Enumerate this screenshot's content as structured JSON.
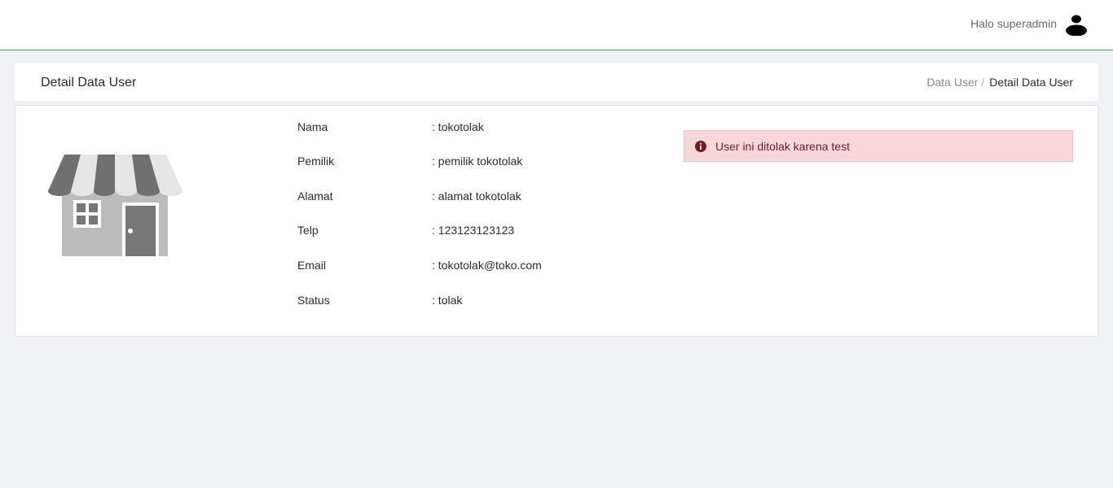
{
  "topbar": {
    "greeting": "Halo superadmin",
    "avatar_icon": "user-icon"
  },
  "header": {
    "title": "Detail Data User",
    "breadcrumb": {
      "link": "Data User",
      "separator": "/",
      "current": "Detail Data User"
    }
  },
  "detail": {
    "image_icon": "shop-storefront-icon",
    "rows": [
      {
        "label": "Nama",
        "value": ": tokotolak"
      },
      {
        "label": "Pemilik",
        "value": ": pemilik tokotolak"
      },
      {
        "label": "Alamat",
        "value": ": alamat tokotolak"
      },
      {
        "label": "Telp",
        "value": ": 123123123123"
      },
      {
        "label": "Email",
        "value": ": tokotolak@toko.com"
      },
      {
        "label": "Status",
        "value": ": tolak"
      }
    ]
  },
  "alert": {
    "icon": "info-circle-icon",
    "message": "User ini ditolak karena test",
    "color": "#721c24",
    "background": "#f8d7da"
  },
  "colors": {
    "accent_line": "#3aa853",
    "page_background": "#f0f1f5"
  }
}
